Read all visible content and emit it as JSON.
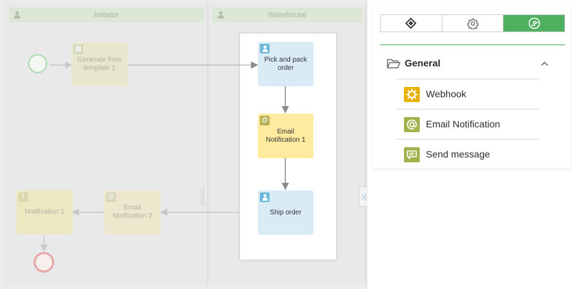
{
  "lanes": [
    {
      "name": "Initiator"
    },
    {
      "name": "Warehouse"
    }
  ],
  "tasks": {
    "generate": {
      "label": "Generate from template 1"
    },
    "pick_pack": {
      "label": "Pick and pack order"
    },
    "email1": {
      "label": "Email Notification 1"
    },
    "ship": {
      "label": "Ship order"
    },
    "email2": {
      "label": "Email Notification 2"
    },
    "notification1": {
      "label": "Notification 1"
    }
  },
  "panel": {
    "tabs": [
      {
        "icon": "diamond-move-icon",
        "active": false
      },
      {
        "icon": "gear-icon",
        "active": false
      },
      {
        "icon": "process-icon",
        "active": true
      }
    ],
    "section": {
      "title": "General",
      "expanded": true
    },
    "items": [
      {
        "label": "Webhook",
        "icon": "webhook-icon",
        "color": "#e9b000"
      },
      {
        "label": "Email Notification",
        "icon": "at-sign-icon",
        "color": "#a2b24a"
      },
      {
        "label": "Send message",
        "icon": "message-icon",
        "color": "#a2b24a"
      }
    ]
  },
  "colors": {
    "accent": "#4fb060",
    "user_task": "#d9ecf6",
    "email_task": "#feeba0",
    "lane_header": "#dde7d5"
  }
}
